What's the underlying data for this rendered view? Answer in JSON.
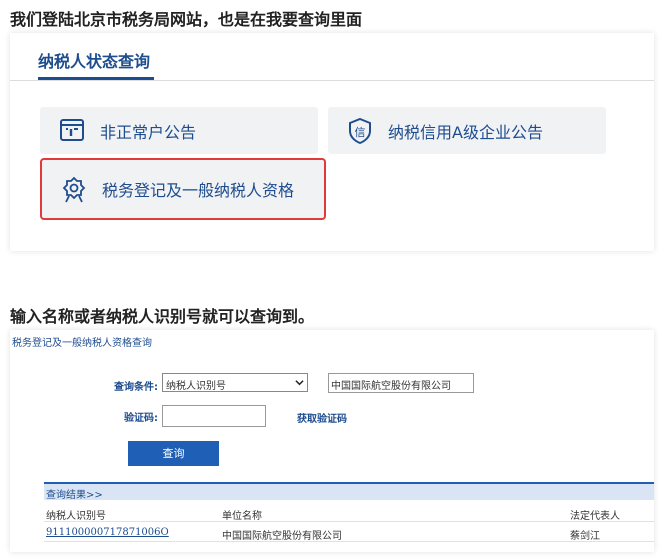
{
  "captions": {
    "top": "我们登陆北京市税务局网站，也是在我要查询里面",
    "middle": "输入名称或者纳税人识别号就可以查询到。"
  },
  "status_panel": {
    "title": "纳税人状态查询",
    "tiles": [
      {
        "label": "非正常户公告",
        "icon": "notice-board-icon"
      },
      {
        "label": "纳税信用A级企业公告",
        "icon": "credit-shield-icon"
      },
      {
        "label": "税务登记及一般纳税人资格",
        "icon": "award-badge-icon",
        "highlighted": true
      }
    ],
    "highlight_color": "#e03a3a"
  },
  "query_form": {
    "title": "税务登记及一般纳税人资格查询",
    "condition_label": "查询条件:",
    "condition_selected": "纳税人识别号",
    "name_value": "中国国际航空股份有限公司",
    "code_label": "验证码:",
    "code_value": "",
    "get_code_link": "获取验证码",
    "query_button": "查询"
  },
  "results": {
    "title": "查询结果>>",
    "columns": [
      "纳税人识别号",
      "单位名称",
      "法定代表人"
    ],
    "rows": [
      [
        "911100000717871006O",
        "中国国际航空股份有限公司",
        "蔡剑江"
      ]
    ]
  },
  "colors": {
    "brand_blue": "#1e4d8f",
    "button_blue": "#1f5fb5"
  }
}
